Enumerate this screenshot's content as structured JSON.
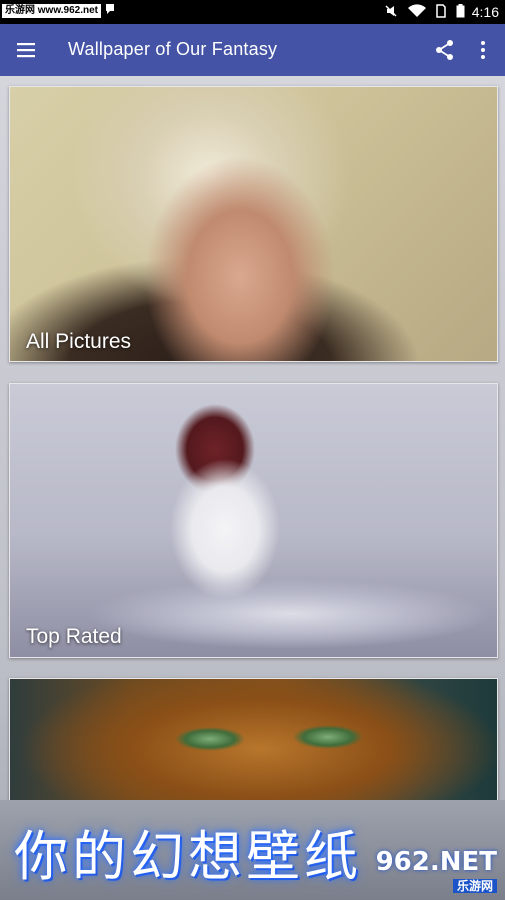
{
  "status_bar": {
    "watermark": "乐游网 www.962.net",
    "time": "4:16",
    "icons": [
      "notification-icon",
      "mute-icon",
      "wifi-icon",
      "sim-icon",
      "battery-icon"
    ]
  },
  "app_bar": {
    "title": "Wallpaper of Our Fantasy",
    "menu_icon": "hamburger-menu-icon",
    "share_icon": "share-icon",
    "more_icon": "more-vert-icon",
    "color": "#4453a6"
  },
  "cards": [
    {
      "label": "All Pictures"
    },
    {
      "label": "Top Rated"
    },
    {
      "label": ""
    }
  ],
  "banner": {
    "text": "你的幻想壁纸",
    "watermark_big": "962.NET",
    "watermark_small": "乐游网"
  }
}
